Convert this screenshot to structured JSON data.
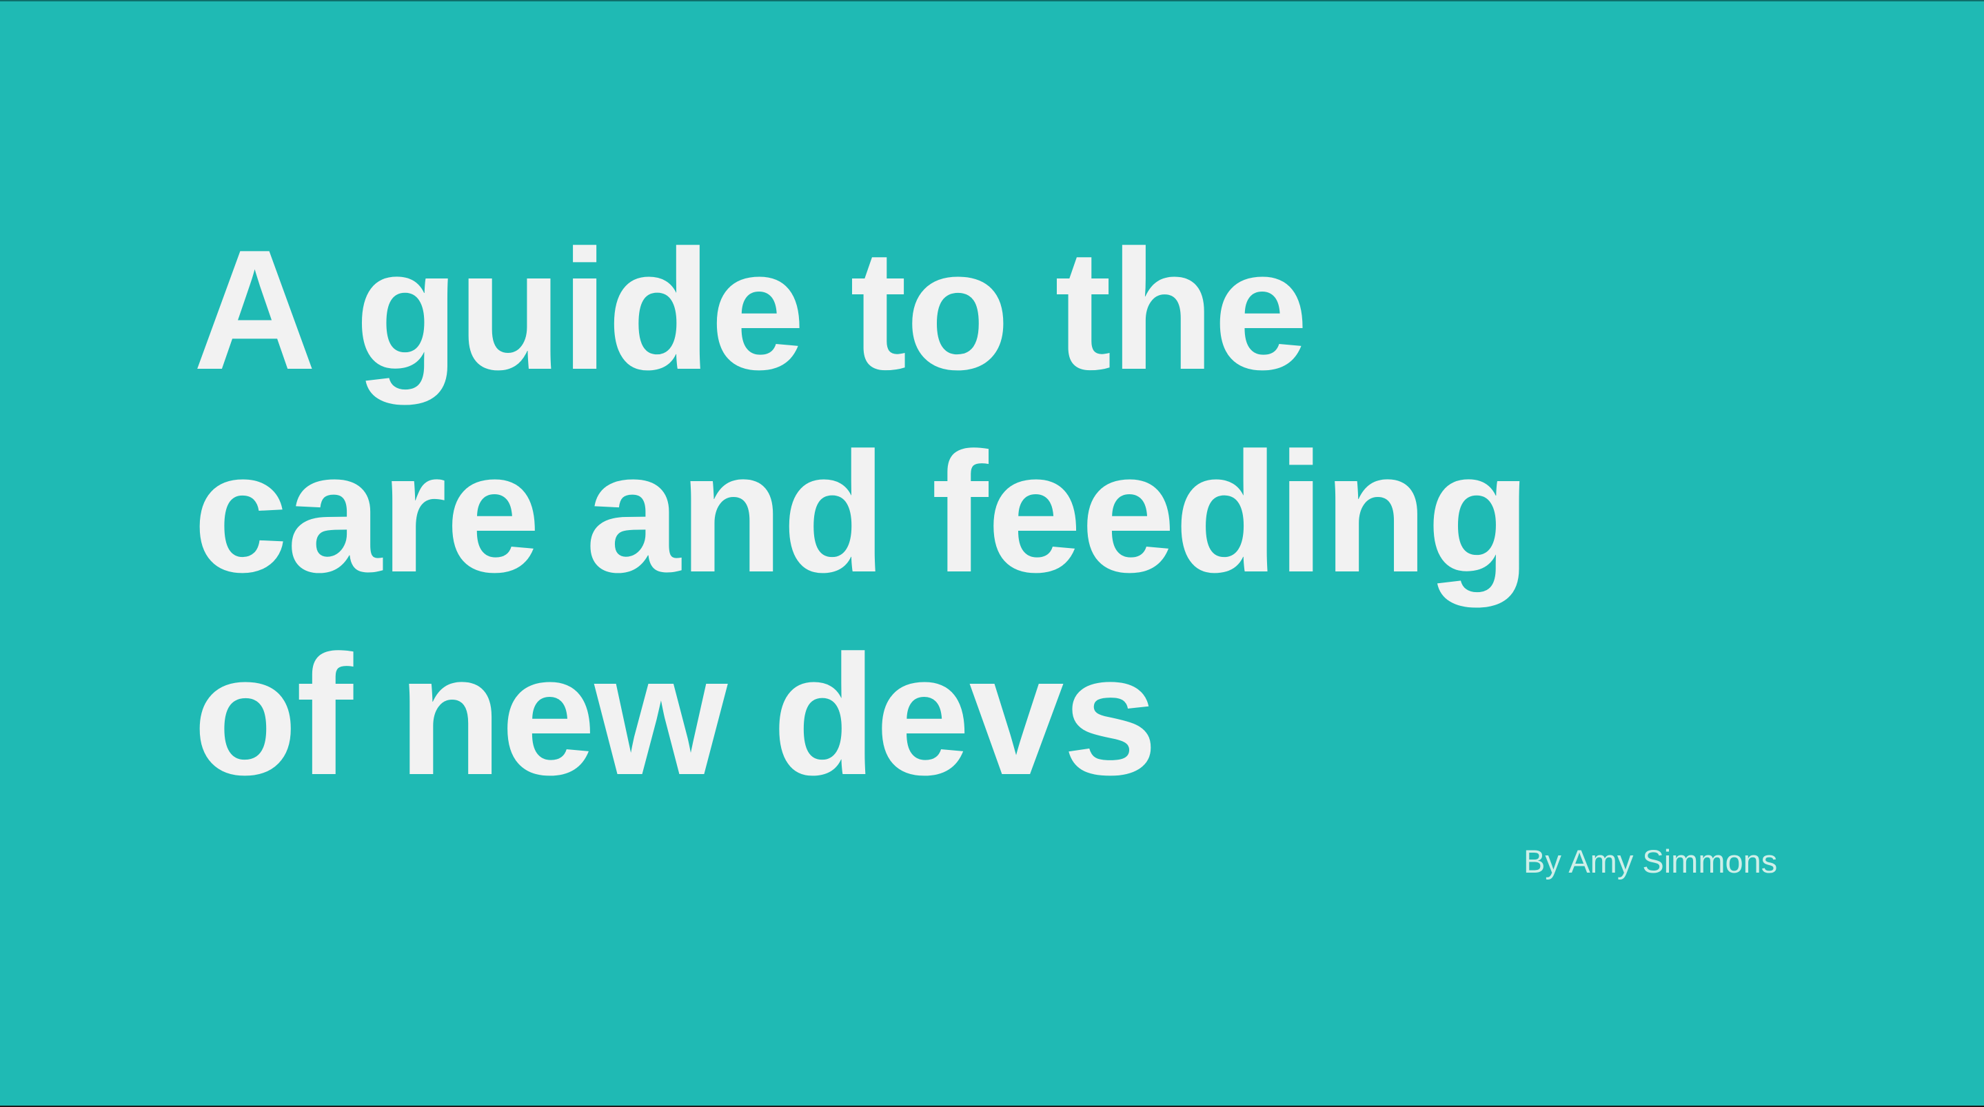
{
  "slide": {
    "title_lines": [
      "A guide to the",
      "care and feeding",
      "of new devs"
    ],
    "byline": "By Amy Simmons"
  },
  "colors": {
    "background": "#1fbab4",
    "title_text": "#f2f2f2",
    "byline_text": "#cfefe9"
  }
}
